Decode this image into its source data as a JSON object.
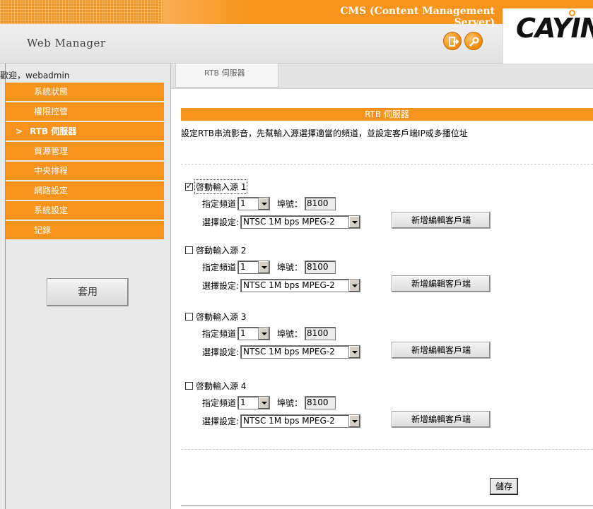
{
  "header": {
    "cms_title": "CMS (Content Management Server)",
    "app_title": "Web Manager",
    "logo_text": "CAYIN",
    "accent_color": "#f7941d",
    "icons": [
      "logout-icon",
      "settings-icon"
    ]
  },
  "sidebar": {
    "welcome": "歡迎，webadmin",
    "items": [
      {
        "label": "系統狀態"
      },
      {
        "label": "權限控管"
      },
      {
        "label": "RTB 伺服器",
        "active": true,
        "arrow": ">"
      },
      {
        "label": "資源管理"
      },
      {
        "label": "中央排程"
      },
      {
        "label": "網路設定"
      },
      {
        "label": "系統設定"
      },
      {
        "label": "記錄"
      }
    ],
    "apply_label": "套用"
  },
  "tabs": [
    {
      "label": "RTB 伺服器",
      "active": true
    }
  ],
  "main": {
    "section_title": "RTB 伺服器",
    "description": "設定RTB串流影音，先幫輸入源選擇適當的頻道，並設定客戶端IP或多播位址",
    "channel_label": "指定頻道",
    "port_label": "埠號：",
    "setting_label": "選擇設定:",
    "client_button": "新增編輯客戶端",
    "save_label": "儲存",
    "sources": [
      {
        "label": "啓動輸入源 1",
        "checked": true,
        "channel": "1",
        "port": "8100",
        "setting": "NTSC 1M bps MPEG-2"
      },
      {
        "label": "啓動輸入源 2",
        "checked": false,
        "channel": "1",
        "port": "8100",
        "setting": "NTSC 1M bps MPEG-2"
      },
      {
        "label": "啓動輸入源 3",
        "checked": false,
        "channel": "1",
        "port": "8100",
        "setting": "NTSC 1M bps MPEG-2"
      },
      {
        "label": "啓動輸入源 4",
        "checked": false,
        "channel": "1",
        "port": "8100",
        "setting": "NTSC 1M bps MPEG-2"
      }
    ]
  }
}
